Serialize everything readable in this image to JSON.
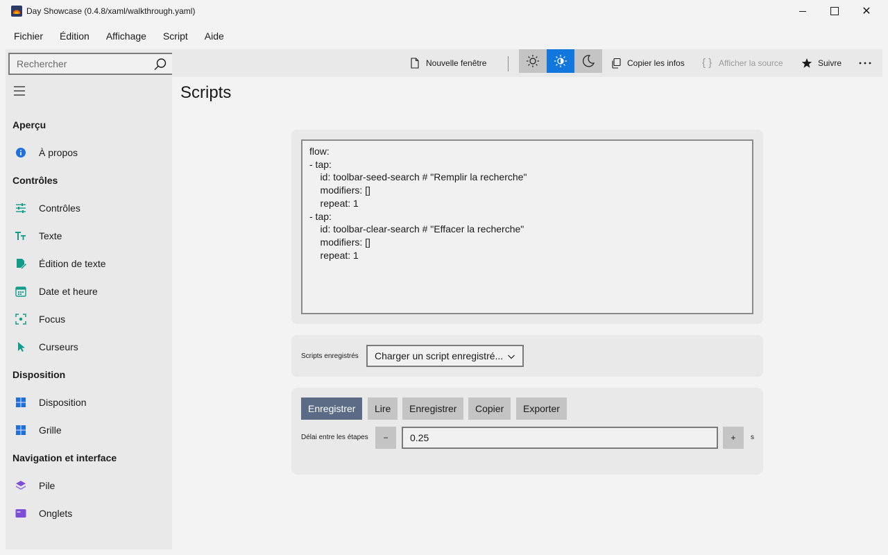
{
  "window": {
    "title": "Day Showcase (0.4.8/xaml/walkthrough.yaml)",
    "minimize_icon": "minimize-icon",
    "maximize_icon": "maximize-icon",
    "close_icon": "close-icon",
    "close_glyph": "✕"
  },
  "menu": [
    "Fichier",
    "Édition",
    "Affichage",
    "Script",
    "Aide"
  ],
  "search": {
    "placeholder": "Rechercher",
    "value": ""
  },
  "sidebar": {
    "sections": [
      {
        "title": "Aperçu",
        "items": [
          {
            "label": "À propos",
            "icon": "info-icon",
            "color": "#1f6fe0"
          }
        ]
      },
      {
        "title": "Contrôles",
        "items": [
          {
            "label": "Contrôles",
            "icon": "sliders-icon",
            "color": "#0f9d8a"
          },
          {
            "label": "Texte",
            "icon": "text-icon",
            "color": "#0f9d8a"
          },
          {
            "label": "Édition de texte",
            "icon": "edit-document-icon",
            "color": "#0f9d8a"
          },
          {
            "label": "Date et heure",
            "icon": "calendar-icon",
            "color": "#0f9d8a"
          },
          {
            "label": "Focus",
            "icon": "focus-icon",
            "color": "#0f9d8a"
          },
          {
            "label": "Curseurs",
            "icon": "cursor-icon",
            "color": "#0f9d8a"
          }
        ]
      },
      {
        "title": "Disposition",
        "items": [
          {
            "label": "Disposition",
            "icon": "layout-icon",
            "color": "#1f6fe0"
          },
          {
            "label": "Grille",
            "icon": "grid-icon",
            "color": "#1f6fe0"
          }
        ]
      },
      {
        "title": "Navigation et interface",
        "items": [
          {
            "label": "Pile",
            "icon": "stack-icon",
            "color": "#7b4fd6"
          },
          {
            "label": "Onglets",
            "icon": "tabs-icon",
            "color": "#7b4fd6"
          }
        ]
      }
    ]
  },
  "toolbar": {
    "new_window": "Nouvelle fenêtre",
    "copy_info": "Copier les infos",
    "show_source": "Afficher la source",
    "follow": "Suivre",
    "more_icon": "more-icon",
    "theme_selected": "auto",
    "accent": "#1177dd"
  },
  "page": {
    "title": "Scripts"
  },
  "editor": {
    "content": "flow:\n- tap:\n    id: toolbar-seed-search # \"Remplir la recherche\"\n    modifiers: []\n    repeat: 1\n- tap:\n    id: toolbar-clear-search # \"Effacer la recherche\"\n    modifiers: []\n    repeat: 1"
  },
  "saved": {
    "label": "Scripts enregistrés",
    "selected": "Charger un script enregistré..."
  },
  "actions": {
    "buttons": [
      "Enregistrer",
      "Lire",
      "Enregistrer",
      "Copier",
      "Exporter"
    ],
    "delay_label": "Délai entre les étapes",
    "decrement": "−",
    "increment": "+",
    "delay_value": "0.25",
    "unit": "s"
  }
}
